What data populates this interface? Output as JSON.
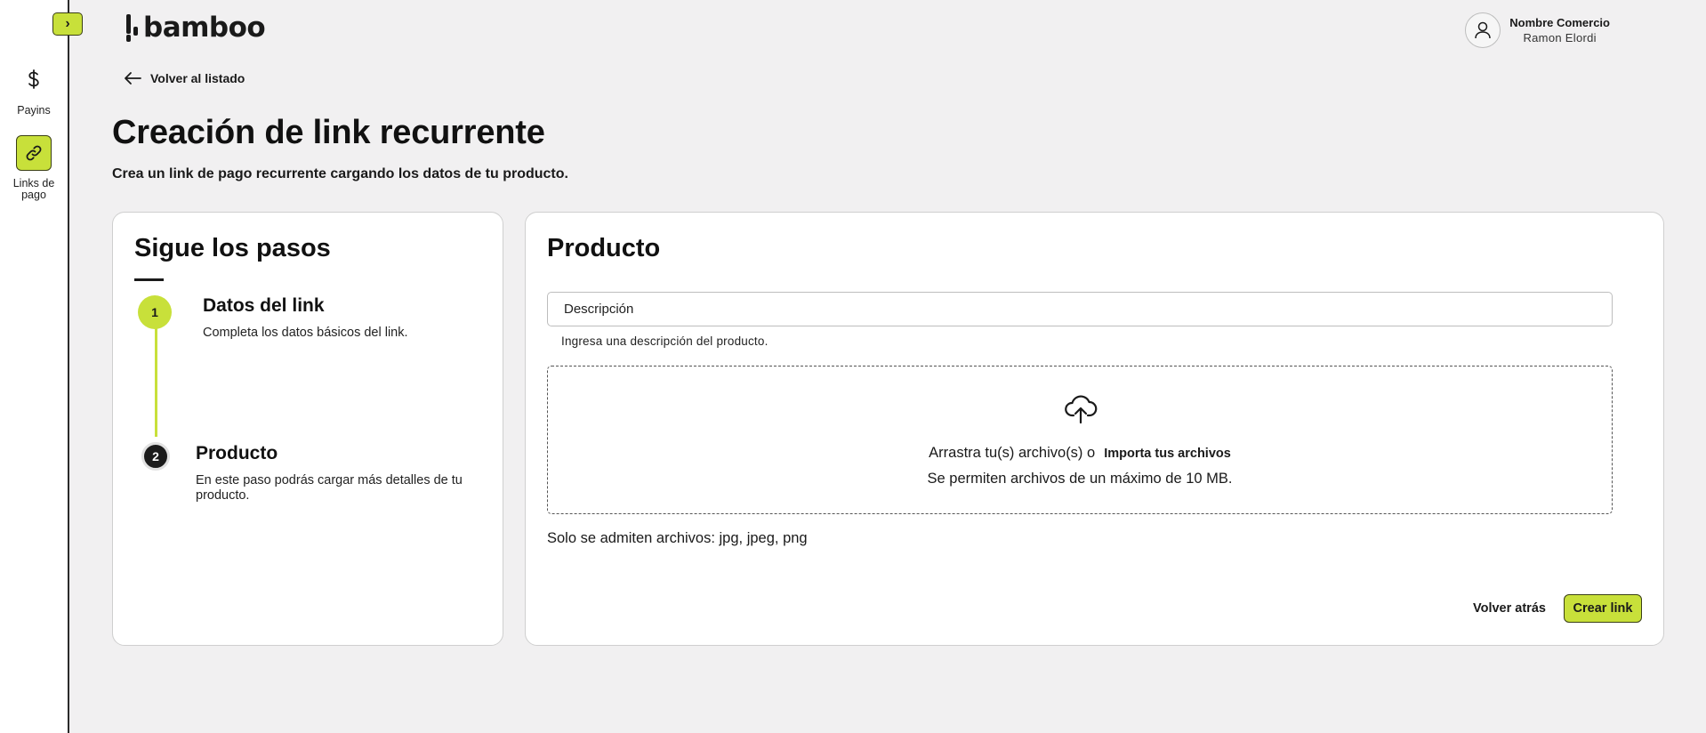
{
  "colors": {
    "accent": "#c8e03a",
    "background": "#f1f0f1",
    "text": "#111111"
  },
  "sidebar": {
    "toggle_icon": "chevron-right-icon",
    "toggle_glyph": "›",
    "items": [
      {
        "label": "Payins",
        "icon": "dollar-icon",
        "active": false
      },
      {
        "label": "Links de pago",
        "icon": "link-icon",
        "active": true
      }
    ]
  },
  "header": {
    "logo_text": "bamboo",
    "user": {
      "company": "Nombre Comercio",
      "name": "Ramon Elordi",
      "icon": "user-icon"
    }
  },
  "back_link": {
    "label": "Volver al listado",
    "icon": "arrow-left-icon"
  },
  "page": {
    "title": "Creación de link recurrente",
    "subtitle": "Crea un link de pago recurrente cargando los datos de tu producto."
  },
  "steps": {
    "title": "Sigue los pasos",
    "items": [
      {
        "number": "1",
        "title": "Datos del link",
        "description": "Completa los datos básicos del link."
      },
      {
        "number": "2",
        "title": "Producto",
        "description": "En este paso podrás cargar más detalles de tu producto."
      }
    ]
  },
  "product": {
    "title": "Producto",
    "description_placeholder": "Descripción",
    "description_helper": "Ingresa una descripción del producto.",
    "dropzone": {
      "icon": "cloud-upload-icon",
      "drag_text": "Arrastra tu(s) archivo(s) o",
      "import_label": "Importa tus archivos",
      "limit_text": "Se permiten archivos de un máximo de 10 MB."
    },
    "accepted_formats": "Solo se admiten archivos: jpg, jpeg, png",
    "back_button": "Volver atrás",
    "create_button": "Crear link"
  }
}
